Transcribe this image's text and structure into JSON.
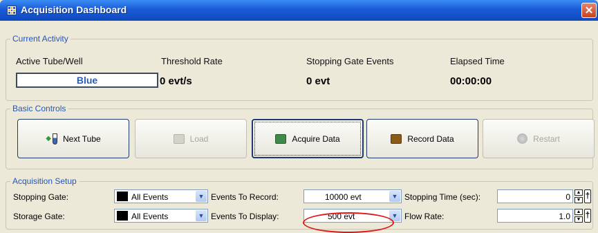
{
  "window": {
    "title": "Acquisition Dashboard"
  },
  "current_activity": {
    "legend": "Current Activity",
    "columns": [
      {
        "label": "Active Tube/Well",
        "value": "Blue"
      },
      {
        "label": "Threshold Rate",
        "value": "0 evt/s"
      },
      {
        "label": "Stopping Gate Events",
        "value": "0 evt"
      },
      {
        "label": "Elapsed Time",
        "value": "00:00:00"
      }
    ]
  },
  "basic_controls": {
    "legend": "Basic Controls",
    "buttons": [
      {
        "label": "Next Tube",
        "enabled": true,
        "icon": "tube-icon"
      },
      {
        "label": "Load",
        "enabled": false,
        "icon": "load-icon"
      },
      {
        "label": "Acquire Data",
        "enabled": true,
        "focused": true,
        "icon": "acquire-icon",
        "color": "#3f8a4a"
      },
      {
        "label": "Record Data",
        "enabled": true,
        "icon": "record-icon",
        "color": "#8a5a18"
      },
      {
        "label": "Restart",
        "enabled": false,
        "icon": "restart-icon"
      }
    ]
  },
  "acquisition_setup": {
    "legend": "Acquisition Setup",
    "stopping_gate": {
      "label": "Stopping Gate:",
      "value": "All Events"
    },
    "storage_gate": {
      "label": "Storage Gate:",
      "value": "All Events"
    },
    "events_to_record": {
      "label": "Events To Record:",
      "value": "10000 evt"
    },
    "events_to_display": {
      "label": "Events To Display:",
      "value": "500 evt"
    },
    "stopping_time": {
      "label": "Stopping Time (sec):",
      "value": "0"
    },
    "flow_rate": {
      "label": "Flow Rate:",
      "value": "1.0"
    }
  },
  "colors": {
    "titlebar": "#1a5bd6",
    "legend": "#2255bb",
    "annotation": "#e01616"
  }
}
